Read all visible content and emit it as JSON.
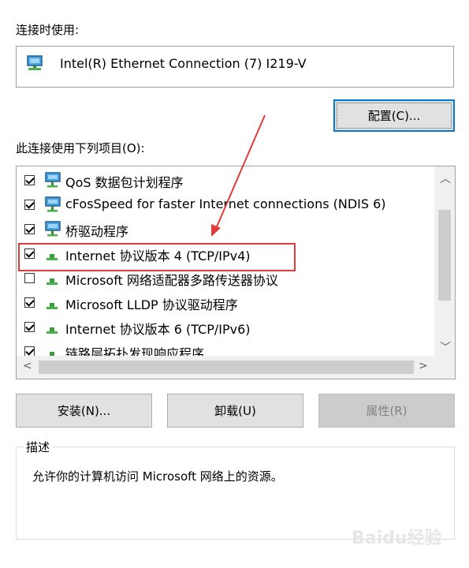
{
  "connect_label": "连接时使用:",
  "adapter": {
    "name": "Intel(R) Ethernet Connection (7) I219-V",
    "icon": "network-adapter-icon"
  },
  "config_button": "配置(C)...",
  "items_label": "此连接使用下列项目(O):",
  "items": [
    {
      "label": "QoS 数据包计划程序",
      "checked": true,
      "icon": "network-service-icon"
    },
    {
      "label": "cFosSpeed for faster Internet connections (NDIS 6)",
      "checked": true,
      "icon": "network-service-icon"
    },
    {
      "label": "桥驱动程序",
      "checked": true,
      "icon": "network-service-icon"
    },
    {
      "label": "Internet 协议版本 4 (TCP/IPv4)",
      "checked": true,
      "icon": "protocol-icon"
    },
    {
      "label": "Microsoft 网络适配器多路传送器协议",
      "checked": false,
      "icon": "protocol-icon"
    },
    {
      "label": "Microsoft LLDP 协议驱动程序",
      "checked": true,
      "icon": "protocol-icon"
    },
    {
      "label": "Internet 协议版本 6 (TCP/IPv6)",
      "checked": true,
      "icon": "protocol-icon"
    },
    {
      "label": "链路层拓扑发现响应程序",
      "checked": true,
      "icon": "protocol-icon"
    }
  ],
  "buttons": {
    "install": "安装(N)...",
    "uninstall": "卸载(U)",
    "properties": "属性(R)"
  },
  "description": {
    "title": "描述",
    "text": "允许你的计算机访问 Microsoft 网络上的资源。"
  },
  "colors": {
    "annotation": "#e23b3b",
    "focus": "#0078d7"
  },
  "watermark": "Baidu经验"
}
